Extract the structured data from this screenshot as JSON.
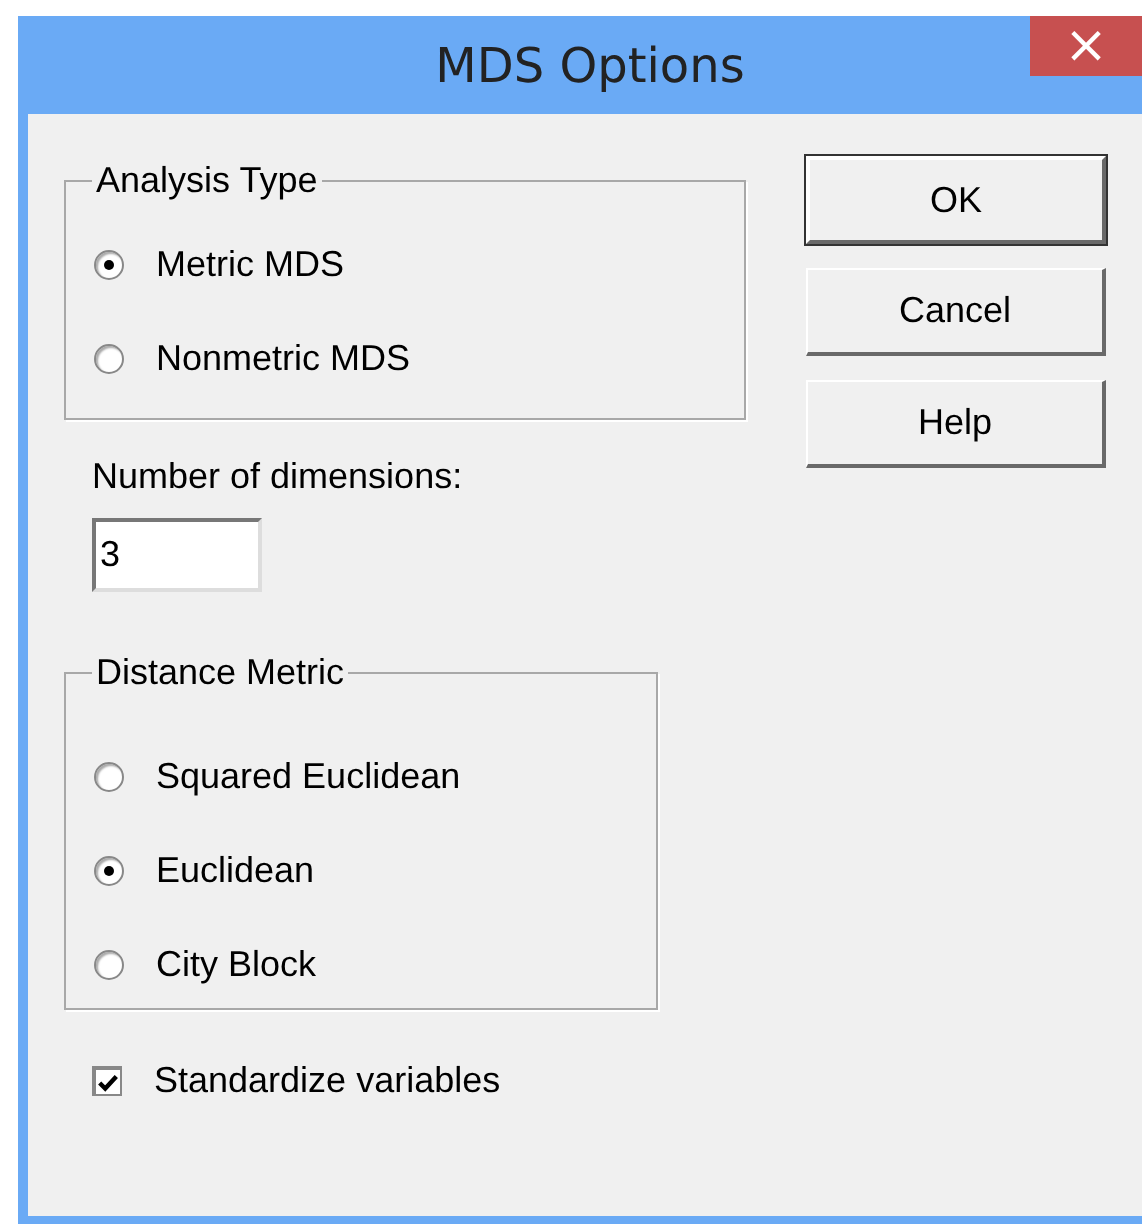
{
  "window": {
    "title": "MDS Options",
    "close": "×"
  },
  "analysis_type": {
    "label": "Analysis Type",
    "options": [
      {
        "label": "Metric MDS",
        "selected": true
      },
      {
        "label": "Nonmetric MDS",
        "selected": false
      }
    ]
  },
  "dimensions": {
    "label": "Number of dimensions:",
    "value": "3"
  },
  "distance_metric": {
    "label": "Distance Metric",
    "options": [
      {
        "label": "Squared Euclidean",
        "selected": false
      },
      {
        "label": "Euclidean",
        "selected": true
      },
      {
        "label": "City Block",
        "selected": false
      }
    ]
  },
  "standardize": {
    "label": "Standardize variables",
    "checked": true
  },
  "buttons": [
    {
      "label": "OK",
      "default": true
    },
    {
      "label": "Cancel",
      "default": false
    },
    {
      "label": "Help",
      "default": false
    }
  ]
}
